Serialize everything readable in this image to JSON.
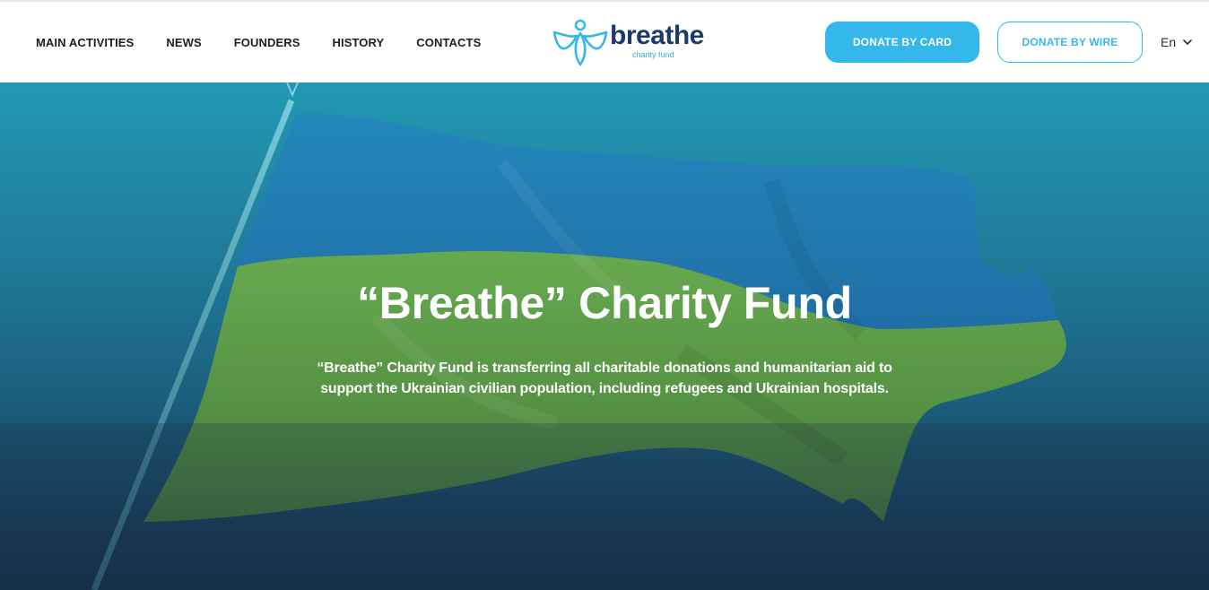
{
  "nav": {
    "items": [
      {
        "label": "MAIN ACTIVITIES"
      },
      {
        "label": "NEWS"
      },
      {
        "label": "FOUNDERS"
      },
      {
        "label": "HISTORY"
      },
      {
        "label": "CONTACTS"
      }
    ]
  },
  "logo": {
    "name": "breathe",
    "tagline": "charity fund",
    "icon": "angel-icon"
  },
  "actions": {
    "donate_card": "DONATE BY CARD",
    "donate_wire": "DONATE BY WIRE"
  },
  "language": {
    "selected": "En",
    "icon": "chevron-down-icon"
  },
  "hero": {
    "title": "“Breathe” Charity Fund",
    "description": "“Breathe” Charity Fund is transferring all charitable donations and humanitarian aid to support the Ukrainian civilian population, including refugees and Ukrainian hospitals."
  },
  "colors": {
    "accent": "#34b8ec",
    "brand_dark": "#1d3a6e",
    "flag_blue": "#1f78b0",
    "flag_yellow": "#7bb23e"
  }
}
